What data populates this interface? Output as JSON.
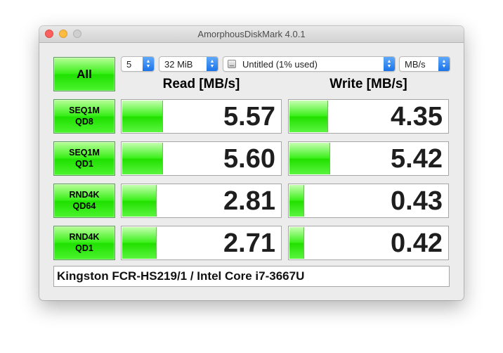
{
  "window": {
    "title": "AmorphousDiskMark 4.0.1"
  },
  "toolbar": {
    "all_label": "All",
    "count_value": "5",
    "size_value": "32 MiB",
    "target_value": "Untitled (1% used)",
    "unit_value": "MB/s"
  },
  "headers": {
    "read": "Read [MB/s]",
    "write": "Write [MB/s]"
  },
  "tests": [
    {
      "line1": "SEQ1M",
      "line2": "QD8",
      "read": "5.57",
      "write": "4.35",
      "read_fraction": 0.25,
      "write_fraction": 0.24
    },
    {
      "line1": "SEQ1M",
      "line2": "QD1",
      "read": "5.60",
      "write": "5.42",
      "read_fraction": 0.25,
      "write_fraction": 0.25
    },
    {
      "line1": "RND4K",
      "line2": "QD64",
      "read": "2.81",
      "write": "0.43",
      "read_fraction": 0.21,
      "write_fraction": 0.09
    },
    {
      "line1": "RND4K",
      "line2": "QD1",
      "read": "2.71",
      "write": "0.42",
      "read_fraction": 0.21,
      "write_fraction": 0.09
    }
  ],
  "comment": "Kingston FCR-HS219/1 / Intel Core i7-3667U",
  "colors": {
    "accent_green": "#22e000",
    "select_blue": "#1a73e8",
    "close": "#fc605c",
    "minimize": "#fdbc40",
    "zoom": "#cfcfcf"
  },
  "icons": {
    "close": "close-icon",
    "minimize": "minimize-icon",
    "zoom": "zoom-icon",
    "disk": "disk-icon",
    "stepper": "chevron-updown-icon"
  }
}
